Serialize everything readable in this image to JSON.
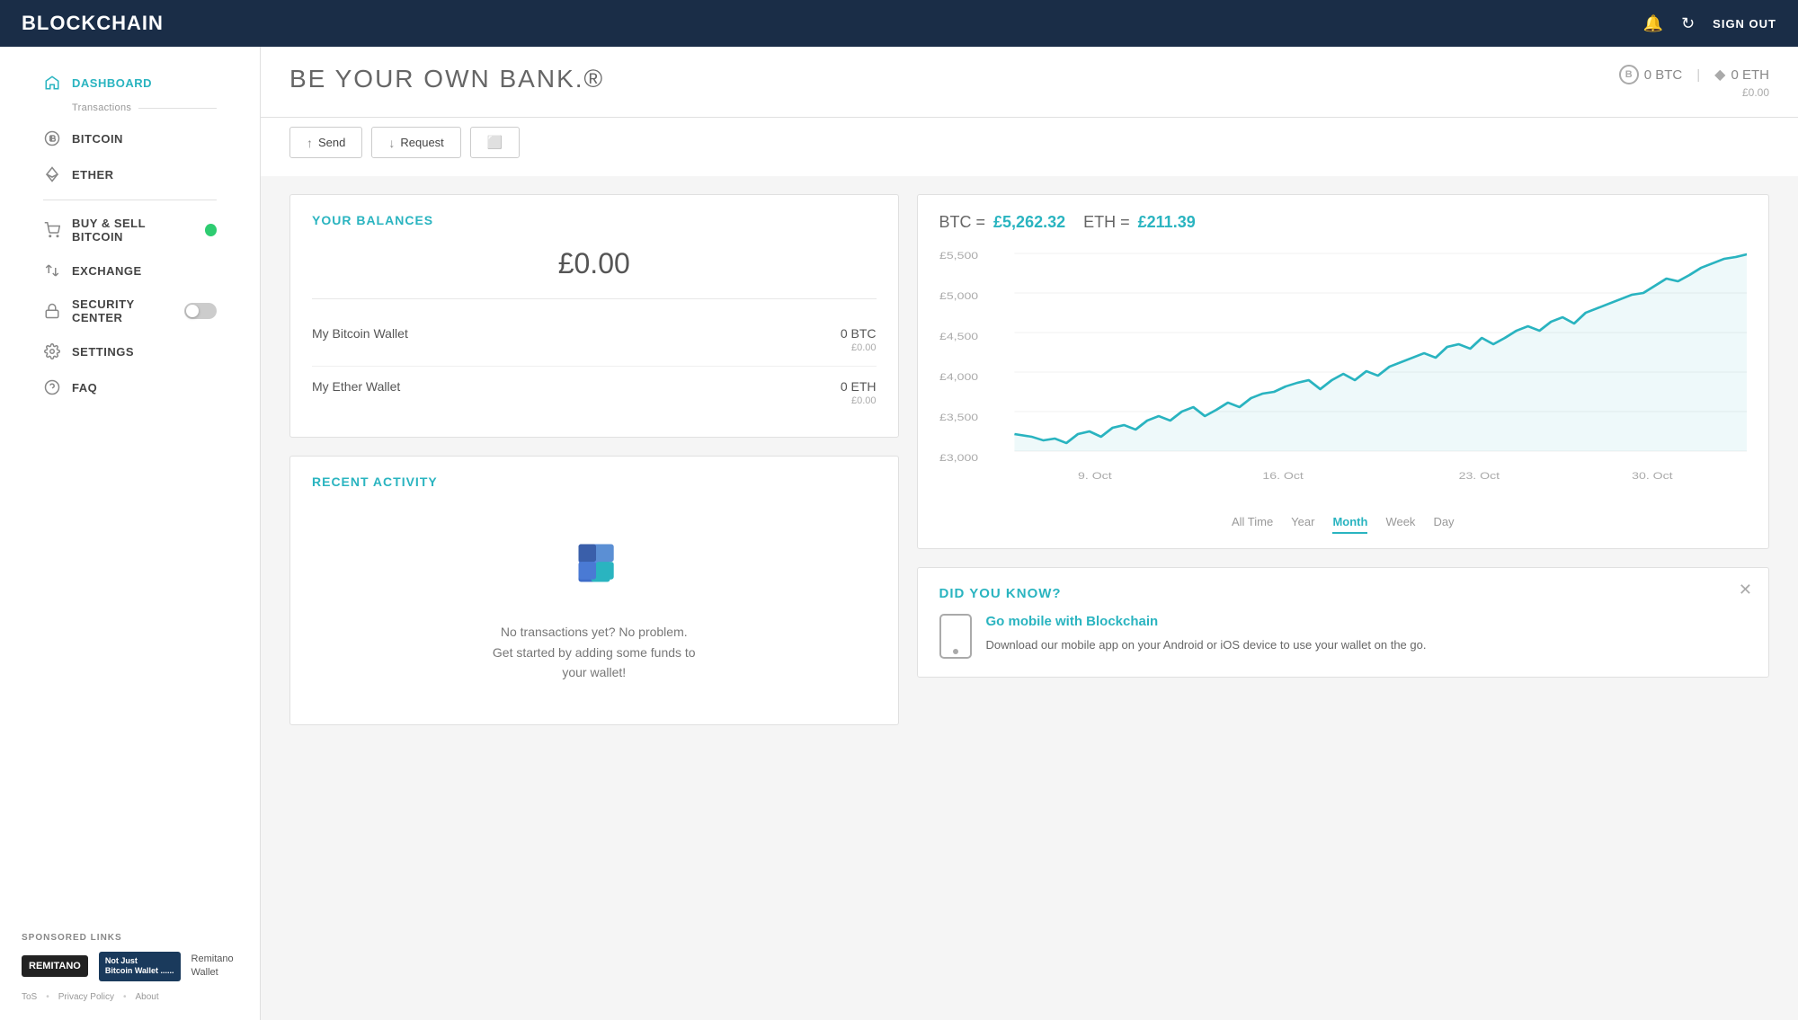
{
  "topnav": {
    "logo": "BLOCKCHAIN",
    "signout_label": "SIGN OUT"
  },
  "sidebar": {
    "nav_items": [
      {
        "id": "dashboard",
        "label": "DASHBOARD",
        "active": true,
        "icon": "home-icon"
      },
      {
        "id": "transactions",
        "sub_label": "Transactions",
        "is_sub": true
      },
      {
        "id": "bitcoin",
        "label": "BITCOIN",
        "active": false,
        "icon": "bitcoin-icon"
      },
      {
        "id": "ether",
        "label": "ETHER",
        "active": false,
        "icon": "ether-icon"
      },
      {
        "id": "buy-sell",
        "label": "BUY & SELL BITCOIN",
        "active": false,
        "icon": "cart-icon",
        "badge": "green"
      },
      {
        "id": "exchange",
        "label": "EXCHANGE",
        "active": false,
        "icon": "exchange-icon"
      },
      {
        "id": "security",
        "label": "SECURITY CENTER",
        "active": false,
        "icon": "lock-icon",
        "has_toggle": true
      },
      {
        "id": "settings",
        "label": "SETTINGS",
        "active": false,
        "icon": "settings-icon"
      },
      {
        "id": "faq",
        "label": "FAQ",
        "active": false,
        "icon": "faq-icon"
      }
    ],
    "sponsored_label": "SPONSORED LINKS",
    "sponsor1_label": "REMITANO",
    "sponsor2_line1": "Not Just",
    "sponsor2_line2": "Bitcoin Wallet ......",
    "sponsor3_name": "Remitano",
    "sponsor3_sub": "Wallet",
    "footer_links": [
      "ToS",
      "Privacy Policy",
      "About"
    ]
  },
  "header": {
    "tagline": "BE YOUR OWN BANK.®",
    "btc_balance": "0 BTC",
    "eth_balance": "0 ETH",
    "total_balance": "£0.00",
    "btc_symbol": "B",
    "eth_symbol": "◆"
  },
  "actions": {
    "send_label": "Send",
    "request_label": "Request",
    "copy_label": ""
  },
  "balances": {
    "section_title": "YOUR BALANCES",
    "total": "£0.00",
    "wallets": [
      {
        "name": "My Bitcoin Wallet",
        "crypto": "0 BTC",
        "fiat": "£0.00"
      },
      {
        "name": "My Ether Wallet",
        "crypto": "0 ETH",
        "fiat": "£0.00"
      }
    ]
  },
  "activity": {
    "section_title": "RECENT ACTIVITY",
    "empty_line1": "No transactions yet? No problem.",
    "empty_line2": "Get started by adding some funds to",
    "empty_line3": "your wallet!"
  },
  "chart": {
    "btc_label": "BTC =",
    "btc_price": "£5,262.32",
    "eth_label": "ETH =",
    "eth_price": "£211.39",
    "tabs": [
      "All Time",
      "Year",
      "Month",
      "Week",
      "Day"
    ],
    "active_tab": "Month",
    "y_labels": [
      "£5,500",
      "£5,000",
      "£4,500",
      "£4,000",
      "£3,500",
      "£3,000"
    ],
    "x_labels": [
      "9. Oct",
      "16. Oct",
      "23. Oct",
      "30. Oct"
    ]
  },
  "did_you_know": {
    "header": "DID YOU KNOW?",
    "link_text": "Go mobile with Blockchain",
    "description": "Download our mobile app on your Android or iOS device to use your wallet on the go."
  }
}
